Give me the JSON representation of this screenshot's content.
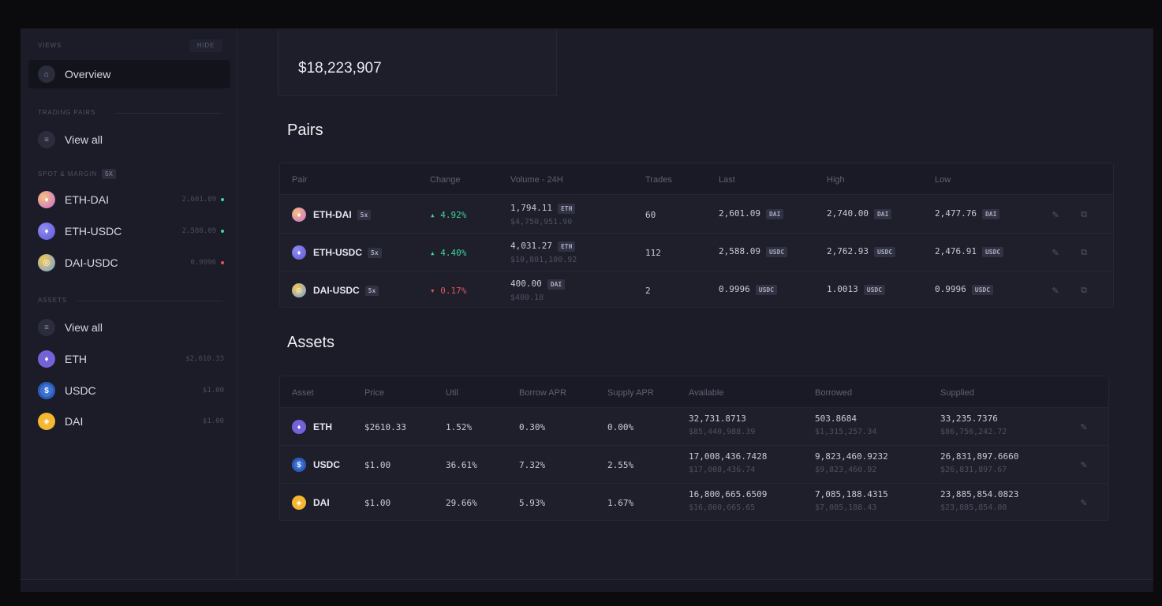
{
  "sidebar": {
    "views_heading": "VIEWS",
    "hide_label": "HIDE",
    "overview_label": "Overview",
    "trading_pairs_heading": "TRADING PAIRS",
    "pairs_view_all": "View all",
    "spot_heading": "SPOT & MARGIN",
    "spot_badge": "5x",
    "pairs": [
      {
        "label": "ETH-DAI",
        "value": "2,601.09",
        "trend": "up"
      },
      {
        "label": "ETH-USDC",
        "value": "2,588.09",
        "trend": "up"
      },
      {
        "label": "DAI-USDC",
        "value": "0.9996",
        "trend": "down"
      }
    ],
    "assets_heading": "ASSETS",
    "assets_view_all": "View all",
    "assets": [
      {
        "label": "ETH",
        "value": "$2,610.33"
      },
      {
        "label": "USDC",
        "value": "$1.00"
      },
      {
        "label": "DAI",
        "value": "$1.00"
      }
    ]
  },
  "total": "$18,223,907",
  "pairs_section": {
    "title": "Pairs",
    "headers": [
      "Pair",
      "Change",
      "Volume - 24H",
      "Trades",
      "Last",
      "High",
      "Low"
    ],
    "rows": [
      {
        "pair": "ETH-DAI",
        "lev": "5x",
        "change": "4.92%",
        "dir": "up",
        "vol": "1,794.11",
        "vol_unit": "ETH",
        "vol_usd": "$4,750,951.90",
        "trades": "60",
        "last": "2,601.09",
        "last_unit": "DAI",
        "high": "2,740.00",
        "high_unit": "DAI",
        "low": "2,477.76",
        "low_unit": "DAI"
      },
      {
        "pair": "ETH-USDC",
        "lev": "5x",
        "change": "4.40%",
        "dir": "up",
        "vol": "4,031.27",
        "vol_unit": "ETH",
        "vol_usd": "$10,801,100.92",
        "trades": "112",
        "last": "2,588.09",
        "last_unit": "USDC",
        "high": "2,762.93",
        "high_unit": "USDC",
        "low": "2,476.91",
        "low_unit": "USDC"
      },
      {
        "pair": "DAI-USDC",
        "lev": "5x",
        "change": "0.17%",
        "dir": "down",
        "vol": "400.00",
        "vol_unit": "DAI",
        "vol_usd": "$400.18",
        "trades": "2",
        "last": "0.9996",
        "last_unit": "USDC",
        "high": "1.0013",
        "high_unit": "USDC",
        "low": "0.9996",
        "low_unit": "USDC"
      }
    ]
  },
  "assets_section": {
    "title": "Assets",
    "headers": [
      "Asset",
      "Price",
      "Util",
      "Borrow APR",
      "Supply APR",
      "Available",
      "Borrowed",
      "Supplied"
    ],
    "rows": [
      {
        "asset": "ETH",
        "price": "$2610.33",
        "util": "1.52%",
        "borrow_apr": "0.30%",
        "supply_apr": "0.00%",
        "available": "32,731.8713",
        "available_usd": "$85,440,988.39",
        "borrowed": "503.8684",
        "borrowed_usd": "$1,315,257.34",
        "supplied": "33,235.7376",
        "supplied_usd": "$86,756,242.72"
      },
      {
        "asset": "USDC",
        "price": "$1.00",
        "util": "36.61%",
        "borrow_apr": "7.32%",
        "supply_apr": "2.55%",
        "available": "17,008,436.7428",
        "available_usd": "$17,008,436.74",
        "borrowed": "9,823,460.9232",
        "borrowed_usd": "$9,823,460.92",
        "supplied": "26,831,897.6660",
        "supplied_usd": "$26,831,897.67"
      },
      {
        "asset": "DAI",
        "price": "$1.00",
        "util": "29.66%",
        "borrow_apr": "5.93%",
        "supply_apr": "1.67%",
        "available": "16,800,665.6509",
        "available_usd": "$16,800,665.65",
        "borrowed": "7,085,188.4315",
        "borrowed_usd": "$7,085,188.43",
        "supplied": "23,885,854.0823",
        "supplied_usd": "$23,885,854.08"
      }
    ]
  },
  "colors": {
    "positive": "#3fd49a",
    "negative": "#e0545d",
    "bg": "#1b1c27"
  },
  "icons": {
    "overview": "home-icon",
    "view_all": "list-icon",
    "edit": "pencil-icon",
    "open": "external-link-icon"
  }
}
